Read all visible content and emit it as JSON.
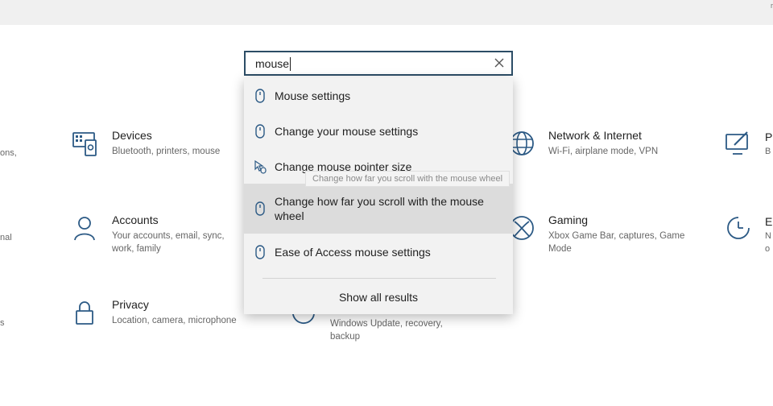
{
  "topbar": {
    "corner_text": "r"
  },
  "search": {
    "value": "mouse"
  },
  "dropdown": {
    "items": [
      {
        "label": "Mouse settings",
        "icon": "mouse-icon"
      },
      {
        "label": "Change your mouse settings",
        "icon": "mouse-icon"
      },
      {
        "label": "Change mouse pointer size",
        "icon": "pointer-size-icon"
      },
      {
        "label": "Change how far you scroll with the mouse wheel",
        "icon": "mouse-icon"
      },
      {
        "label": "Ease of Access mouse settings",
        "icon": "mouse-icon"
      }
    ],
    "tooltip": "Change how far you scroll with the mouse wheel",
    "show_all": "Show all results"
  },
  "tiles": {
    "devices": {
      "title": "Devices",
      "desc": "Bluetooth, printers, mouse",
      "icon": "devices-icon"
    },
    "accounts": {
      "title": "Accounts",
      "desc": "Your accounts, email, sync, work, family",
      "icon": "accounts-icon"
    },
    "privacy": {
      "title": "Privacy",
      "desc": "Location, camera, microphone",
      "icon": "lock-icon"
    },
    "update": {
      "desc": "Windows Update, recovery, backup",
      "icon": "update-icon"
    },
    "network": {
      "title": "Network & Internet",
      "desc": "Wi-Fi, airplane mode, VPN",
      "icon": "globe-icon"
    },
    "gaming": {
      "title": "Gaming",
      "desc": "Xbox Game Bar, captures, Game Mode",
      "icon": "xbox-icon"
    }
  },
  "edge_left": {
    "row1": "ons,",
    "row2": "nal",
    "row3": "s"
  },
  "edge_right": {
    "row1_title": "P",
    "row1_desc": "B",
    "row2_title": "E",
    "row2_desc_1": "N",
    "row2_desc_2": "o"
  },
  "colors": {
    "accent": "#2c5a85",
    "search_border": "#2c4d66"
  }
}
